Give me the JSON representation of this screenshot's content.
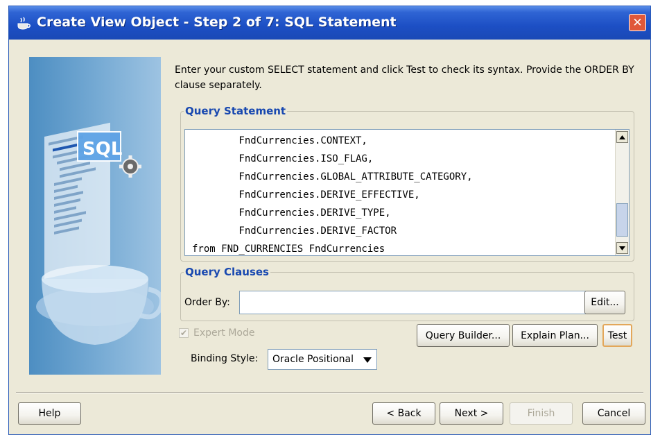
{
  "window": {
    "title": "Create View Object - Step 2 of 7: SQL Statement",
    "close_glyph": "✕"
  },
  "intro_text": "Enter your custom SELECT statement and click Test to check its syntax.  Provide the ORDER BY clause separately.",
  "query_statement": {
    "legend": "Query Statement",
    "lines": [
      "        FndCurrencies.CONTEXT,",
      "        FndCurrencies.ISO_FLAG,",
      "        FndCurrencies.GLOBAL_ATTRIBUTE_CATEGORY,",
      "        FndCurrencies.DERIVE_EFFECTIVE,",
      "        FndCurrencies.DERIVE_TYPE,",
      "        FndCurrencies.DERIVE_FACTOR",
      "from FND_CURRENCIES FndCurrencies"
    ]
  },
  "query_clauses": {
    "legend": "Query Clauses",
    "order_by_label": "Order By:",
    "order_by_value": "",
    "edit_button": "Edit..."
  },
  "expert_mode": {
    "label": "Expert Mode",
    "checked": true,
    "enabled": false
  },
  "buttons": {
    "query_builder": "Query Builder...",
    "explain_plan": "Explain Plan...",
    "test": "Test"
  },
  "binding_style": {
    "label": "Binding Style:",
    "value": "Oracle Positional"
  },
  "footer": {
    "help": "Help",
    "back": "< Back",
    "next": "Next >",
    "finish": "Finish",
    "cancel": "Cancel"
  },
  "side_image": {
    "caption": "SQL"
  },
  "colors": {
    "title_bar": "#1c4fc4",
    "legend_text": "#1848b0",
    "close_button": "#e0583a",
    "focus_border": "#e3a75a",
    "disabled_text": "#aca899"
  },
  "icons": {
    "window_icon": "coffee-cup-icon",
    "close": "close-icon",
    "scroll_up": "scroll-up-arrow-icon",
    "scroll_down": "scroll-down-arrow-icon",
    "dropdown": "chevron-down-icon",
    "gear": "gear-icon"
  }
}
